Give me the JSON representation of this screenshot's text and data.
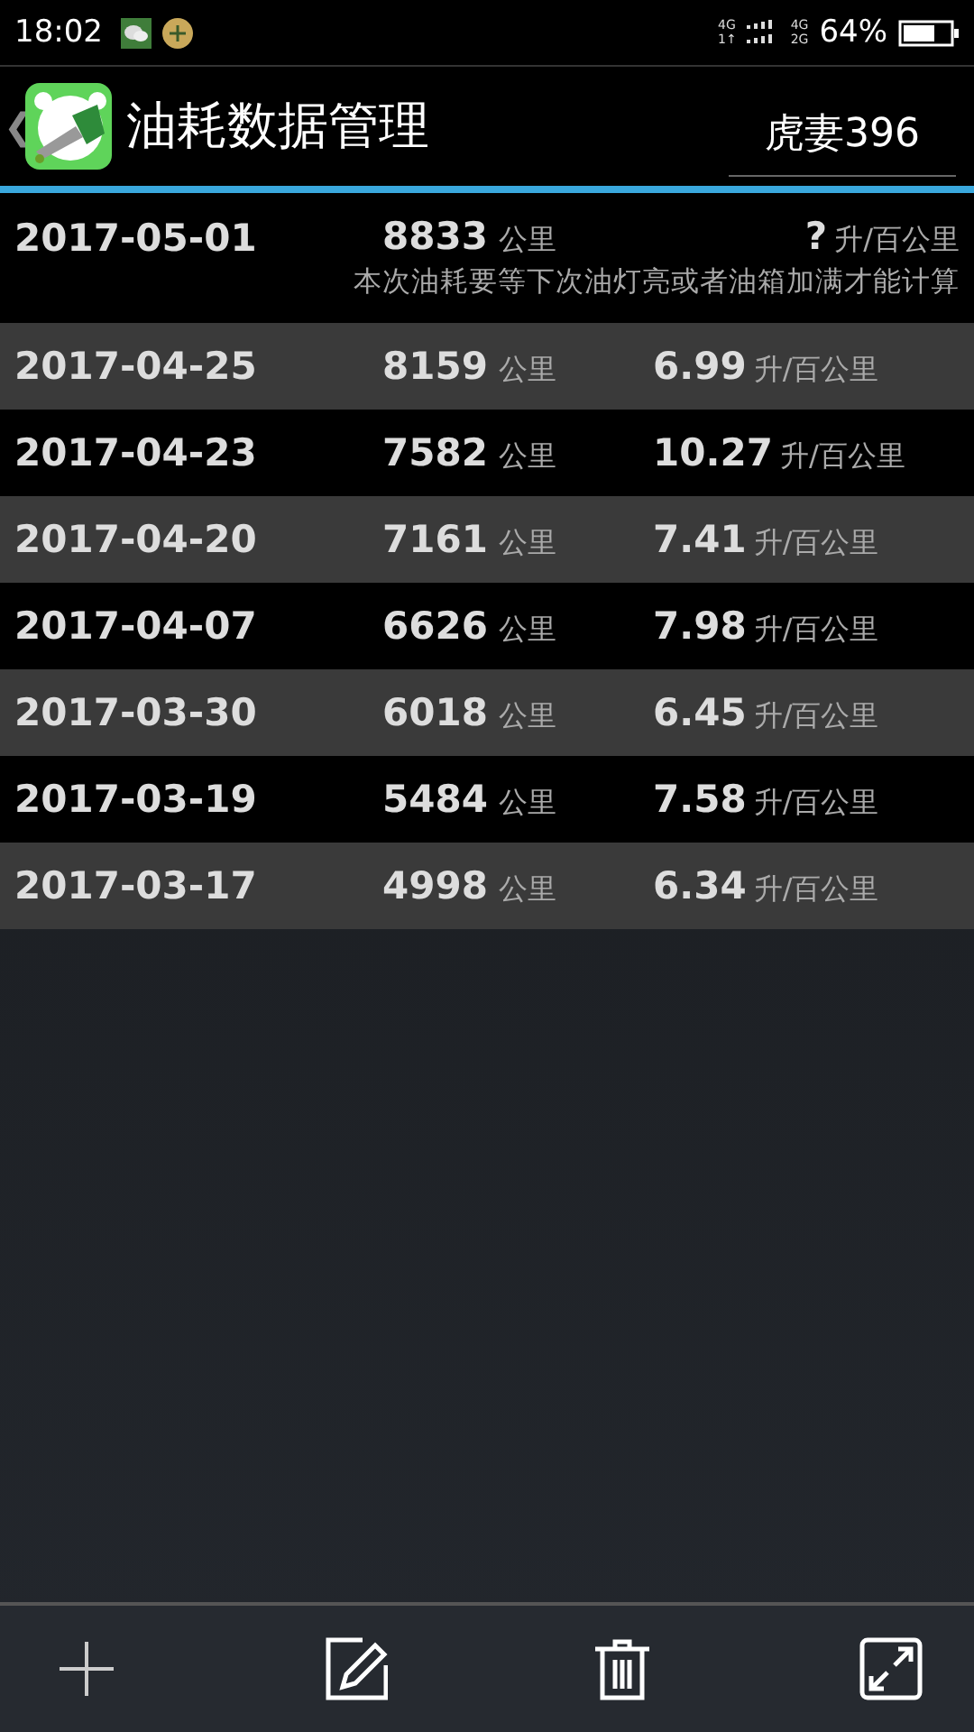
{
  "status_bar": {
    "time": "18:02",
    "network_top": "4G",
    "network_bottom": "1↑",
    "network2_top": "4G",
    "network2_bottom": "2G",
    "battery": "64%"
  },
  "header": {
    "back": "❮",
    "title": "油耗数据管理",
    "vehicle": "虎妻396"
  },
  "records": [
    {
      "date": "2017-05-01",
      "mileage": "8833",
      "mileage_unit": "公里",
      "consumption": "?",
      "consumption_unit": "升/百公里",
      "note": "本次油耗要等下次油灯亮或者油箱加满才能计算"
    },
    {
      "date": "2017-04-25",
      "mileage": "8159",
      "mileage_unit": "公里",
      "consumption": "6.99",
      "consumption_unit": "升/百公里"
    },
    {
      "date": "2017-04-23",
      "mileage": "7582",
      "mileage_unit": "公里",
      "consumption": "10.27",
      "consumption_unit": "升/百公里"
    },
    {
      "date": "2017-04-20",
      "mileage": "7161",
      "mileage_unit": "公里",
      "consumption": "7.41",
      "consumption_unit": "升/百公里"
    },
    {
      "date": "2017-04-07",
      "mileage": "6626",
      "mileage_unit": "公里",
      "consumption": "7.98",
      "consumption_unit": "升/百公里"
    },
    {
      "date": "2017-03-30",
      "mileage": "6018",
      "mileage_unit": "公里",
      "consumption": "6.45",
      "consumption_unit": "升/百公里"
    },
    {
      "date": "2017-03-19",
      "mileage": "5484",
      "mileage_unit": "公里",
      "consumption": "7.58",
      "consumption_unit": "升/百公里"
    },
    {
      "date": "2017-03-17",
      "mileage": "4998",
      "mileage_unit": "公里",
      "consumption": "6.34",
      "consumption_unit": "升/百公里"
    }
  ]
}
